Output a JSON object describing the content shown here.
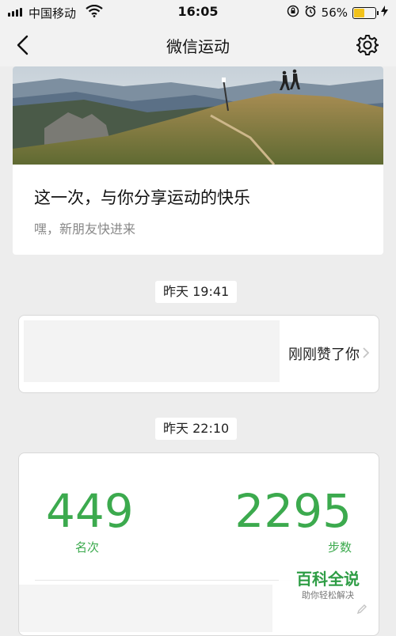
{
  "status_bar": {
    "carrier": "中国移动",
    "time": "16:05",
    "battery_percent": "56%",
    "battery_level": 0.56
  },
  "nav": {
    "title": "微信运动",
    "back_icon": "chevron-left-icon",
    "settings_icon": "gear-icon"
  },
  "share_card": {
    "headline": "这一次，与你分享运动的快乐",
    "subtitle": "嘿，新朋友快进来"
  },
  "feed": [
    {
      "timestamp": "昨天 19:41",
      "text": "刚刚赞了你"
    },
    {
      "timestamp": "昨天 22:10"
    }
  ],
  "stats": {
    "rank_value": "449",
    "rank_label": "名次",
    "steps_value": "2295",
    "steps_label": "步数"
  },
  "watermark": {
    "main": "百科全说",
    "sub": "助你轻松解决"
  },
  "colors": {
    "accent_green": "#3caa4e",
    "background": "#ededed",
    "battery": "#f2c21a"
  }
}
